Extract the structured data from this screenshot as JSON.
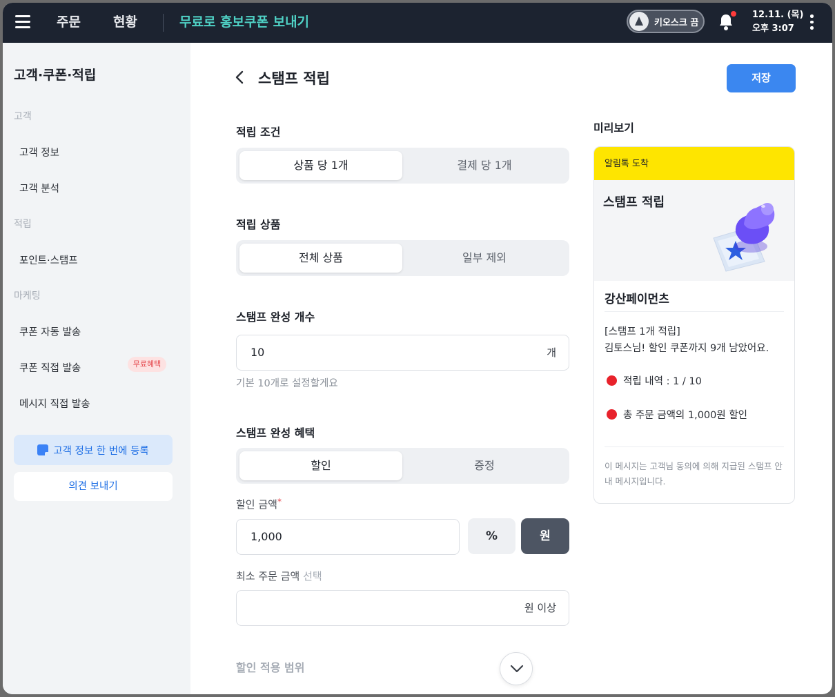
{
  "topbar": {
    "nav_order": "주문",
    "nav_status": "현황",
    "promo_link": "무료로 홍보쿠폰 보내기",
    "kiosk_toggle_label": "키오스크 끔",
    "date": "12.11. (목)",
    "time": "오후 3:07"
  },
  "sidebar": {
    "title": "고객·쿠폰·적립",
    "sections": {
      "customer": "고객",
      "points": "적립",
      "marketing": "마케팅"
    },
    "items": {
      "customer_info": "고객 정보",
      "customer_analysis": "고객 분석",
      "point_stamp": "포인트·스탬프",
      "coupon_auto": "쿠폰 자동 발송",
      "coupon_direct": "쿠폰 직접 발송",
      "message_direct": "메시지 직접 발송"
    },
    "badge_free": "무료혜택",
    "register_button": "고객 정보 한 번에 등록",
    "feedback_button": "의견 보내기"
  },
  "main": {
    "title": "스탬프 적립",
    "save_button": "저장",
    "condition": {
      "label": "적립 조건",
      "option_selected": "상품 당 1개",
      "option_other": "결제 당 1개"
    },
    "products": {
      "label": "적립 상품",
      "option_selected": "전체 상품",
      "option_other": "일부 제외"
    },
    "count": {
      "label": "스탬프 완성 개수",
      "value": "10",
      "unit": "개",
      "helper": "기본 10개로 설정할게요"
    },
    "benefit": {
      "label": "스탬프 완성 혜택",
      "option_selected": "할인",
      "option_other": "증정"
    },
    "discount": {
      "label": "할인 금액",
      "required_mark": "*",
      "value": "1,000",
      "unit_percent": "%",
      "unit_won": "원"
    },
    "min_order": {
      "label": "최소 주문 금액",
      "optional": "선택",
      "unit": "원 이상"
    },
    "scope": {
      "label": "할인 적용 범위"
    }
  },
  "preview": {
    "label": "미리보기",
    "header": "알림톡 도착",
    "hero_title": "스탬프 적립",
    "store_name": "강산페이먼츠",
    "line1": "[스탬프 1개 적립]",
    "line2": "김토스님! 할인 쿠폰까지 9개 남았어요.",
    "bullet1": "적립 내역 : 1 / 10",
    "bullet2": "총 주문 금액의 1,000원 할인",
    "footer": "이 메시지는 고객님 동의에 의해 지급된 스탬프 안내 메시지입니다."
  },
  "colors": {
    "topbar_bg": "#1c2330",
    "promo_link": "#4fd1c5",
    "primary_button": "#3b87f0",
    "kakao_yellow": "#fee500",
    "unit_selected": "#4d5563",
    "stamp_purple": "#6b4ff6"
  }
}
